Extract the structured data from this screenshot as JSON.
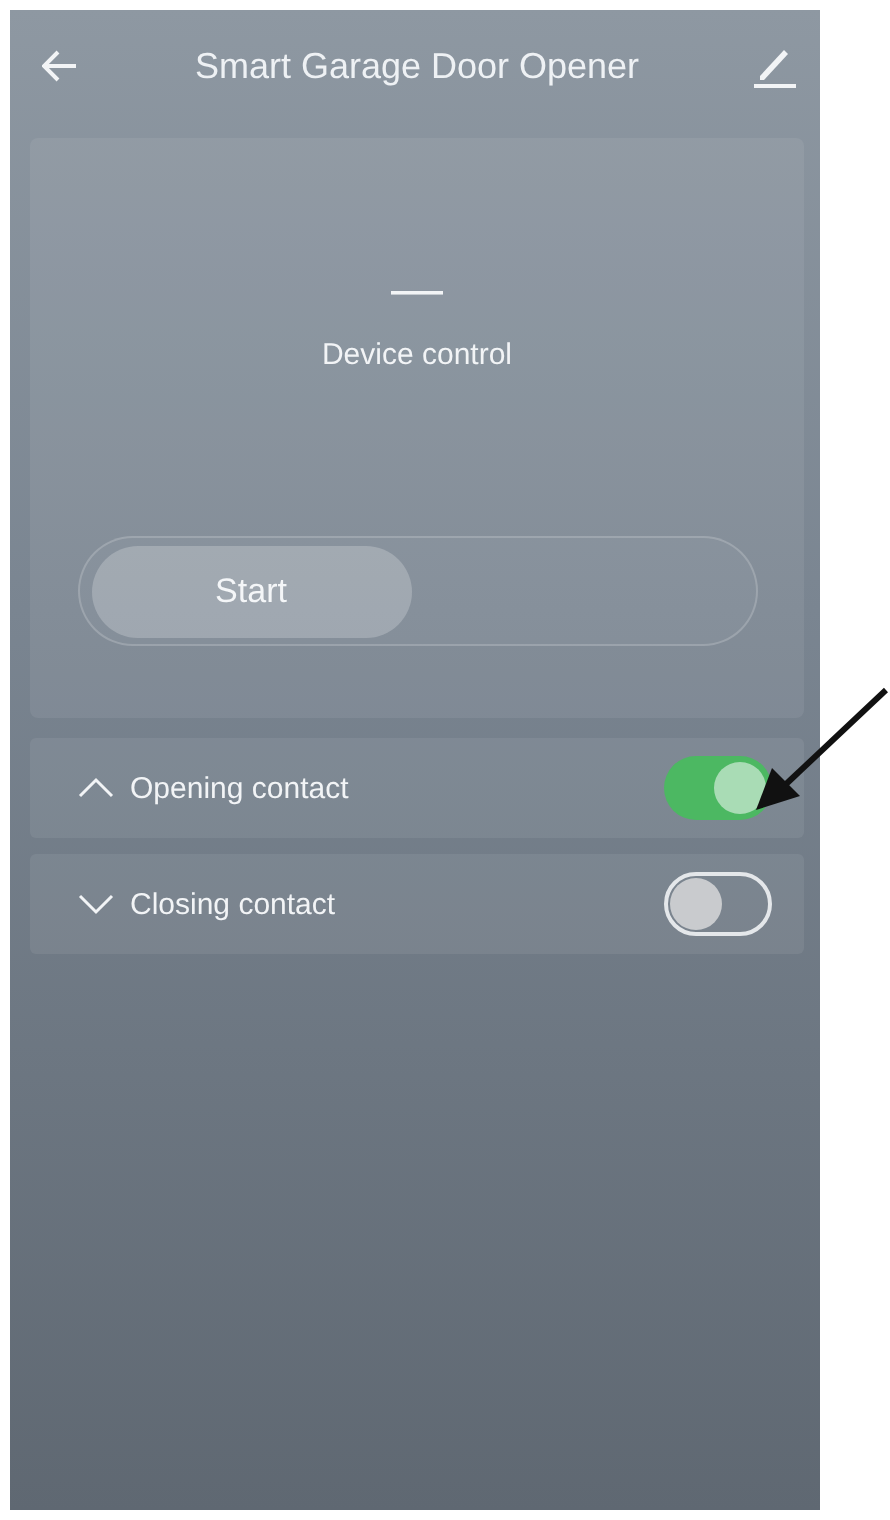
{
  "header": {
    "title": "Smart Garage Door Opener"
  },
  "control_card": {
    "status": "—",
    "caption": "Device control",
    "start_button": {
      "label": "Start"
    }
  },
  "contacts": [
    {
      "label": "Opening contact",
      "kind": "up",
      "on": true
    },
    {
      "label": "Closing contact",
      "kind": "down",
      "on": false
    }
  ]
}
